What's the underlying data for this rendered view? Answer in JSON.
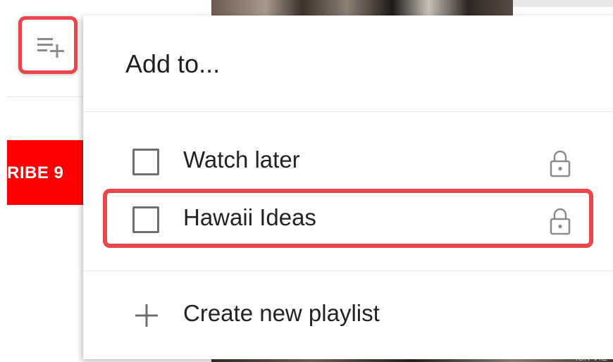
{
  "background": {
    "subscribe_text": "RIBE  9",
    "thumb_caption": "ISK VIE"
  },
  "dialog": {
    "title": "Add to...",
    "playlists": [
      {
        "label": "Watch later",
        "checked": false,
        "privacy_icon": "lock-icon"
      },
      {
        "label": "Hawaii Ideas",
        "checked": false,
        "privacy_icon": "lock-icon"
      }
    ],
    "create_label": "Create new playlist"
  },
  "colors": {
    "highlight": "#e9474b",
    "subscribe": "#ff0000",
    "icon_gray": "#6e6e6e"
  },
  "icons": {
    "save_button": "playlist-add-icon",
    "create": "plus-icon"
  }
}
